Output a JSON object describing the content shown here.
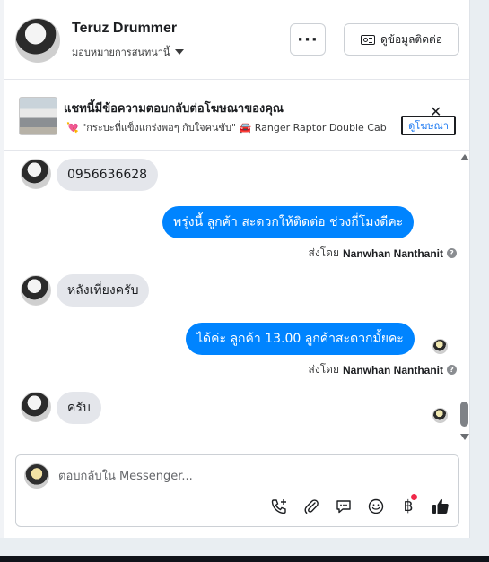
{
  "header": {
    "contact_name": "Teruz Drummer",
    "assign_label": "มอบหมายการสนทนานี้",
    "more_label": "···",
    "contact_info_label": "ดูข้อมูลติดต่อ"
  },
  "ad_banner": {
    "title": "แชทนี้มีข้อความตอบกลับต่อโฆษณาของคุณ",
    "subtitle": "\"กระบะที่แข็งแกร่งพอๆ กับใจคนขับ\"",
    "ad_name": "Ranger Raptor Double Cab",
    "view_ad_label": "ดูโฆษณา",
    "close_label": "✕"
  },
  "messages": [
    {
      "direction": "in",
      "text": "0956636628"
    },
    {
      "direction": "out",
      "text": "พรุ่งนี้ ลูกค้า สะดวกให้ติดต่อ ช่วงกี่โมงดีคะ",
      "sent_by_label": "ส่งโดย",
      "sender": "Nanwhan Nanthanit"
    },
    {
      "direction": "in",
      "text": "หลังเที่ยงครับ"
    },
    {
      "direction": "out",
      "text": "ได้ค่ะ  ลูกค้า  13.00 ลูกค้าสะดวกมั้ยคะ",
      "sent_by_label": "ส่งโดย",
      "sender": "Nanwhan Nanthanit"
    },
    {
      "direction": "in",
      "text": "ครับ"
    }
  ],
  "composer": {
    "placeholder": "ตอบกลับใน Messenger...",
    "tools": [
      "phone-add-icon",
      "paperclip-icon",
      "saved-reply-icon",
      "emoji-icon",
      "baht-icon",
      "thumbs-up-icon"
    ]
  },
  "colors": {
    "outgoing_bubble": "#0084ff",
    "incoming_bubble": "#e4e6eb",
    "link": "#1877f2",
    "notification_dot": "#f02849"
  }
}
